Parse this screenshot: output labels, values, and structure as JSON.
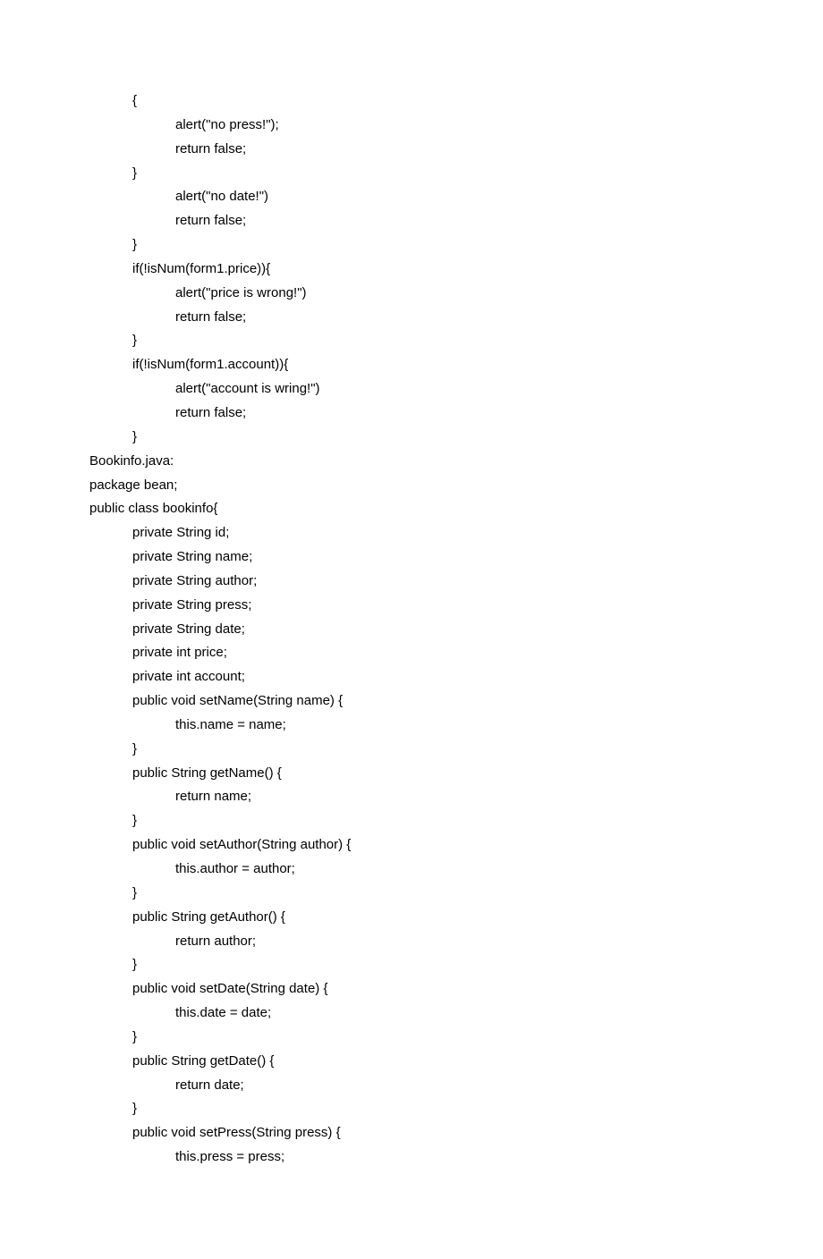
{
  "lines": [
    {
      "indent": 1,
      "text": "{"
    },
    {
      "indent": 2,
      "text": "alert(\"no press!\");"
    },
    {
      "indent": 2,
      "text": "return false;"
    },
    {
      "indent": 1,
      "text": "}"
    },
    {
      "indent": 2,
      "text": "alert(\"no date!\")"
    },
    {
      "indent": 2,
      "text": "return false;"
    },
    {
      "indent": 1,
      "text": "}"
    },
    {
      "indent": 1,
      "text": "if(!isNum(form1.price)){"
    },
    {
      "indent": 2,
      "text": "alert(\"price is wrong!\")"
    },
    {
      "indent": 2,
      "text": "return false;"
    },
    {
      "indent": 1,
      "text": "}"
    },
    {
      "indent": 1,
      "text": "if(!isNum(form1.account)){"
    },
    {
      "indent": 2,
      "text": "alert(\"account is wring!\")"
    },
    {
      "indent": 2,
      "text": "return false;"
    },
    {
      "indent": 1,
      "text": "}"
    },
    {
      "indent": 0,
      "text": "Bookinfo.java:"
    },
    {
      "indent": 0,
      "text": "package bean;"
    },
    {
      "indent": 0,
      "text": "public class bookinfo{"
    },
    {
      "indent": 1,
      "text": "private String id;"
    },
    {
      "indent": 1,
      "text": "private String name;"
    },
    {
      "indent": 1,
      "text": "private String author;"
    },
    {
      "indent": 1,
      "text": "private String press;"
    },
    {
      "indent": 1,
      "text": "private String date;"
    },
    {
      "indent": 1,
      "text": "private int price;"
    },
    {
      "indent": 1,
      "text": "private int account;"
    },
    {
      "indent": 1,
      "text": "public void setName(String name) {"
    },
    {
      "indent": 2,
      "text": "this.name = name;"
    },
    {
      "indent": 1,
      "text": "}"
    },
    {
      "indent": 1,
      "text": "public String getName() {"
    },
    {
      "indent": 2,
      "text": "return name;"
    },
    {
      "indent": 1,
      "text": "}"
    },
    {
      "indent": 1,
      "text": "public void setAuthor(String author) {"
    },
    {
      "indent": 2,
      "text": "this.author = author;"
    },
    {
      "indent": 1,
      "text": "}"
    },
    {
      "indent": 1,
      "text": "public String getAuthor() {"
    },
    {
      "indent": 2,
      "text": "return author;"
    },
    {
      "indent": 1,
      "text": "}"
    },
    {
      "indent": 1,
      "text": "public void setDate(String date) {"
    },
    {
      "indent": 2,
      "text": "this.date = date;"
    },
    {
      "indent": 1,
      "text": "}"
    },
    {
      "indent": 1,
      "text": "public String getDate() {"
    },
    {
      "indent": 2,
      "text": "return date;"
    },
    {
      "indent": 1,
      "text": "}"
    },
    {
      "indent": 1,
      "text": "public void setPress(String press) {"
    },
    {
      "indent": 2,
      "text": "this.press = press;"
    }
  ]
}
